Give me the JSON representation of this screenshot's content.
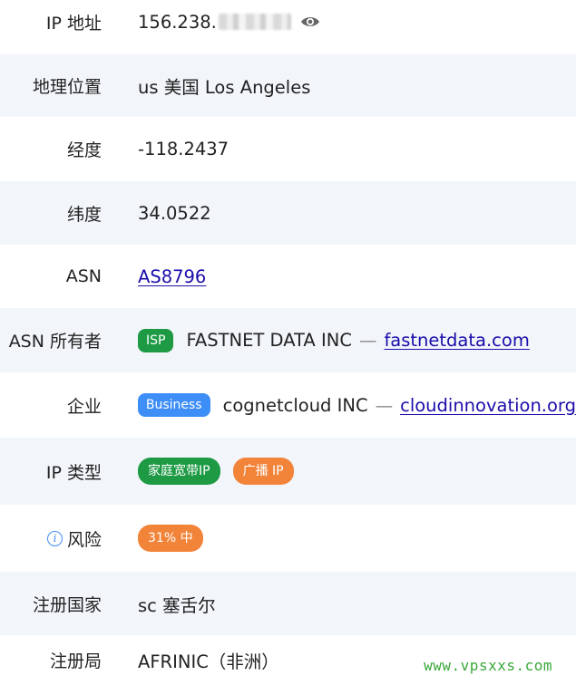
{
  "rows": {
    "ip": {
      "label": "IP 地址",
      "value_prefix": "156.238."
    },
    "geo": {
      "label": "地理位置",
      "value": "us 美国 Los Angeles"
    },
    "longitude": {
      "label": "经度",
      "value": "-118.2437"
    },
    "latitude": {
      "label": "纬度",
      "value": "34.0522"
    },
    "asn": {
      "label": "ASN",
      "link": "AS8796"
    },
    "asn_owner": {
      "label": "ASN 所有者",
      "badge": "ISP",
      "name": "FASTNET DATA INC",
      "separator": "—",
      "link": "fastnetdata.com"
    },
    "company": {
      "label": "企业",
      "badge": "Business",
      "name": "cognetcloud INC",
      "separator": "—",
      "link": "cloudinnovation.org"
    },
    "ip_type": {
      "label": "IP 类型",
      "badges": [
        "家庭宽带IP",
        "广播 IP"
      ]
    },
    "risk": {
      "label": "风险",
      "info_icon_char": "i",
      "badge": "31% 中"
    },
    "reg_country": {
      "label": "注册国家",
      "value": "sc 塞舌尔"
    },
    "registry": {
      "label": "注册局",
      "value": "AFRINIC（非洲）"
    }
  },
  "watermark": "www.vpsxxs.com",
  "colors": {
    "green": "#1e9a45",
    "blue": "#3e8ef7",
    "orange": "#f2843a",
    "link": "#1a0dab",
    "shaded_row": "#f2f5fa"
  },
  "icons": {
    "reveal": "eye-icon",
    "info": "info-circle-icon"
  }
}
